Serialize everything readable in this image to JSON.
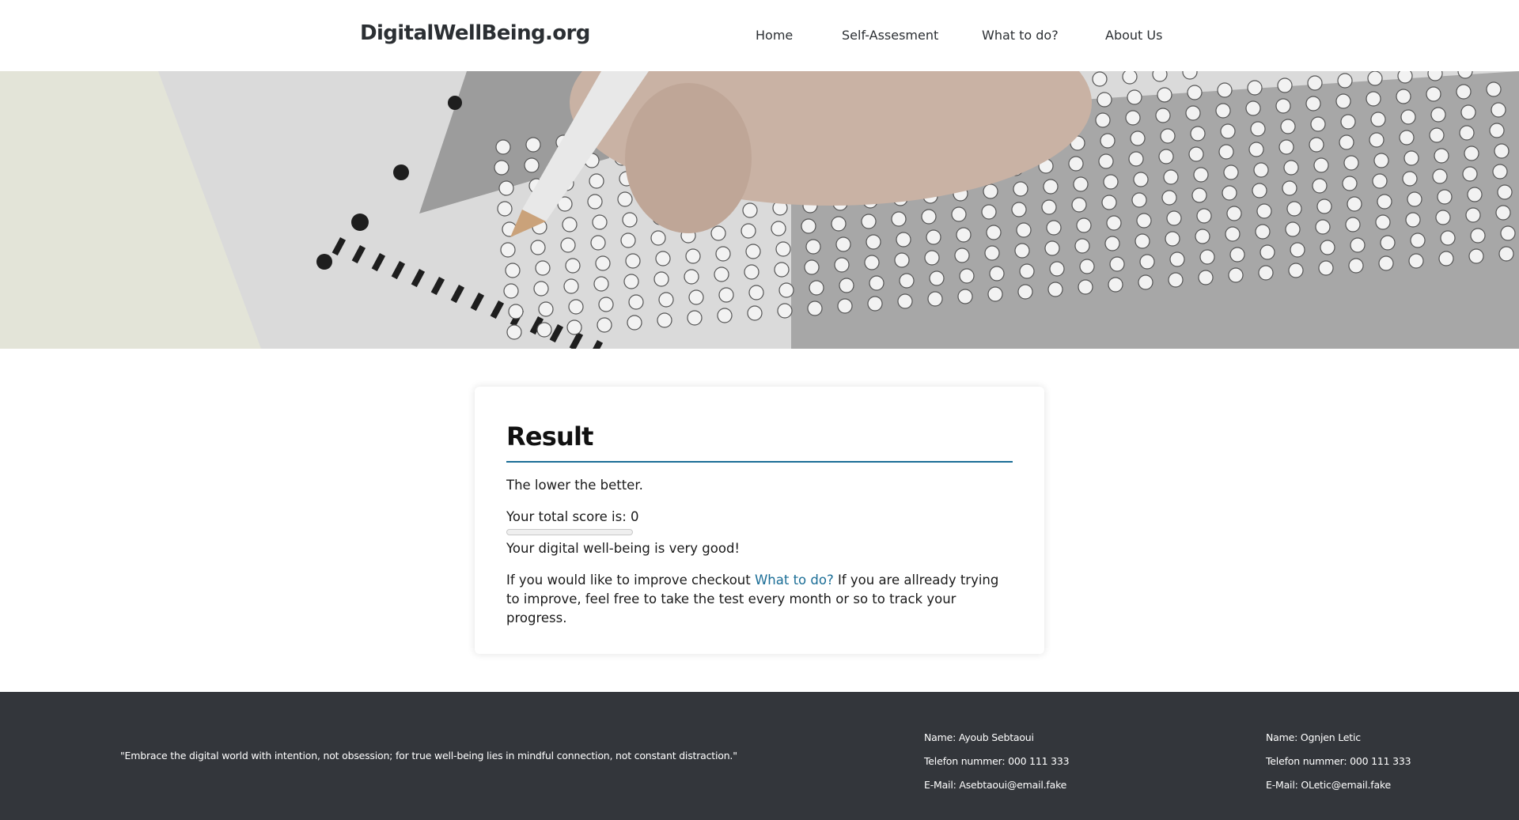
{
  "header": {
    "logo": "DigitalWellBeing.org",
    "nav": {
      "home": "Home",
      "self_assessment": "Self-Assesment",
      "what_to_do": "What to do?",
      "about": "About Us"
    }
  },
  "result": {
    "title": "Result",
    "lower_better": "The lower the better.",
    "score_text": "Your total score is: 0",
    "score_value": 0,
    "verdict": "Your digital well-being is very good!",
    "improve_prefix": "If you would like to improve checkout",
    "improve_link": "What to do?",
    "improve_suffix": "If you are allready trying to improve, feel free to take the test every month or so to track your progress."
  },
  "footer": {
    "quote": "\"Embrace the digital world with intention, not obsession; for true well-being lies in mindful connection, not constant distraction.\"",
    "contacts": [
      {
        "name": "Name: Ayoub Sebtaoui",
        "phone": "Telefon nummer: 000 111 333",
        "email": "E-Mail: Asebtaoui@email.fake"
      },
      {
        "name": "Name: Ognjen Letic",
        "phone": "Telefon nummer: 000 111 333",
        "email": "E-Mail: OLetic@email.fake"
      }
    ]
  },
  "colors": {
    "accent": "#1a6d96",
    "footer_bg": "#33363b",
    "text": "#2b2f33"
  }
}
